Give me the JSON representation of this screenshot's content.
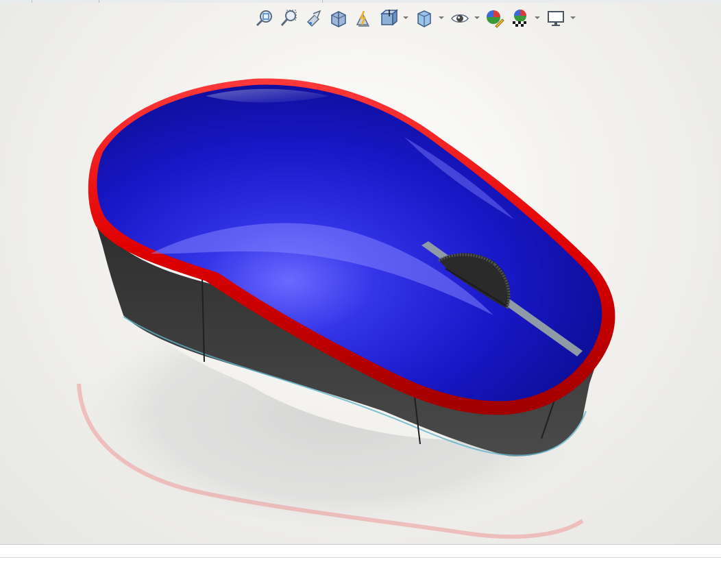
{
  "window": {
    "tabs": [
      "",
      "",
      ""
    ]
  },
  "heads_up_toolbar": {
    "tools": [
      {
        "name": "zoom-to-fit",
        "icon": "zoom-to-fit-icon"
      },
      {
        "name": "zoom-to-area",
        "icon": "zoom-to-area-icon"
      },
      {
        "name": "previous-view",
        "icon": "previous-view-icon"
      },
      {
        "name": "section-view",
        "icon": "section-view-icon"
      },
      {
        "name": "dynamic-annotation-views",
        "icon": "annotation-views-icon"
      },
      {
        "name": "view-orientation",
        "icon": "view-orientation-icon",
        "dropdown": true
      },
      {
        "name": "display-style",
        "icon": "display-style-icon",
        "dropdown": true
      },
      {
        "name": "hide-show-items",
        "icon": "eye-icon",
        "dropdown": true
      },
      {
        "name": "edit-appearance",
        "icon": "edit-appearance-icon"
      },
      {
        "name": "apply-scene",
        "icon": "apply-scene-icon",
        "dropdown": true
      },
      {
        "name": "view-settings",
        "icon": "monitor-icon",
        "dropdown": true
      }
    ]
  },
  "model": {
    "name": "",
    "colors": {
      "top_shell": "#1c1cd6",
      "trim": "#e41010",
      "base": "#3e3e3e",
      "scroll_wheel": "#2a2a2a",
      "slot": "#8e9aa6"
    }
  },
  "viewport": {
    "background": "#f3f2ee"
  }
}
